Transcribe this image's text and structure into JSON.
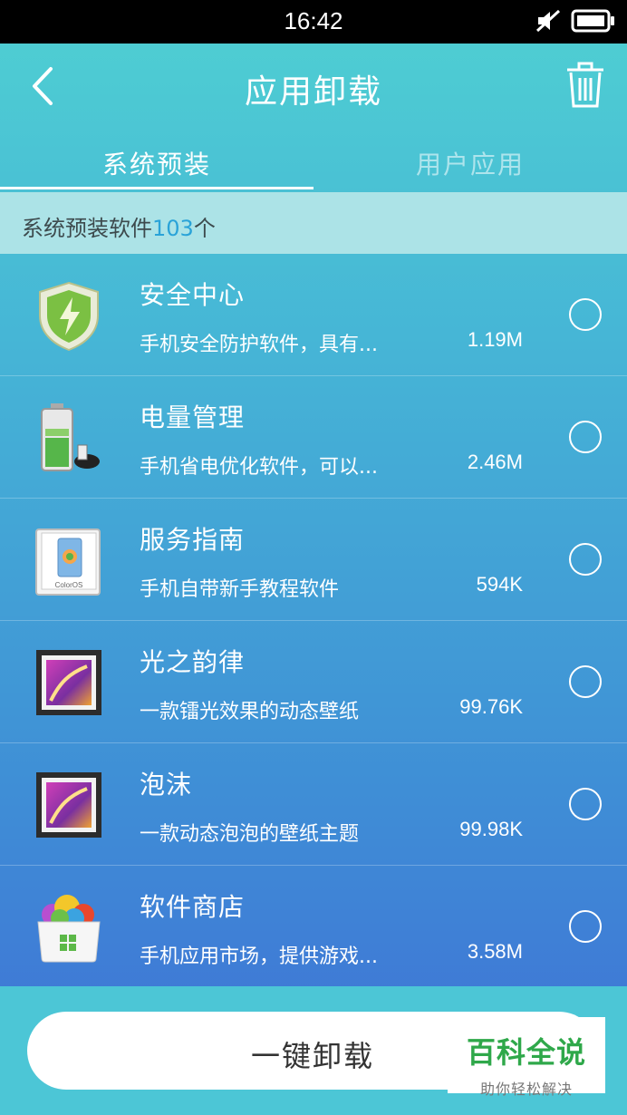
{
  "status_bar": {
    "time": "16:42"
  },
  "header": {
    "title": "应用卸载"
  },
  "tabs": [
    {
      "label": "系统预装"
    },
    {
      "label": "用户应用"
    }
  ],
  "count_bar": {
    "prefix": "系统预装软件",
    "count": "103",
    "suffix": "个"
  },
  "apps": [
    {
      "name": "安全中心",
      "description": "手机安全防护软件，具有...",
      "size": "1.19M",
      "icon": "shield-icon"
    },
    {
      "name": "电量管理",
      "description": "手机省电优化软件，可以...",
      "size": "2.46M",
      "icon": "battery-icon"
    },
    {
      "name": "服务指南",
      "description": "手机自带新手教程软件",
      "size": "594K",
      "icon": "guide-book-icon",
      "icon_text": "ColorOS"
    },
    {
      "name": "光之韵律",
      "description": "一款镭光效果的动态壁纸",
      "size": "99.76K",
      "icon": "wallpaper-icon"
    },
    {
      "name": "泡沫",
      "description": "一款动态泡泡的壁纸主题",
      "size": "99.98K",
      "icon": "wallpaper-icon"
    },
    {
      "name": "软件商店",
      "description": "手机应用市场，提供游戏...",
      "size": "3.58M",
      "icon": "app-store-icon"
    }
  ],
  "bottom": {
    "button_label": "一键卸载"
  },
  "watermark": {
    "main": "百科全说",
    "sub": "助你轻松解决"
  }
}
